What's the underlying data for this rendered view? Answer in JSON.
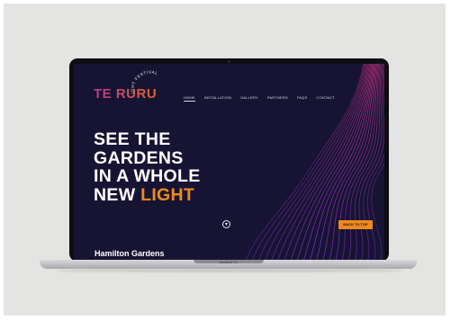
{
  "brand": {
    "logo_text": "TE RURU",
    "tagline": "LIGHT FESTIVAL"
  },
  "nav": {
    "items": [
      {
        "label": "HOME",
        "active": true
      },
      {
        "label": "INSTALLATION",
        "active": false
      },
      {
        "label": "GALLERY",
        "active": false
      },
      {
        "label": "PARTNERS",
        "active": false
      },
      {
        "label": "FAQS",
        "active": false
      },
      {
        "label": "CONTACT",
        "active": false
      }
    ]
  },
  "hero": {
    "line1": "SEE THE",
    "line2": "GARDENS",
    "line3": "IN A WHOLE",
    "line4_prefix": "NEW",
    "line4_accent": "LIGHT",
    "scroll_icon": "chevron-down-icon"
  },
  "back_to_top_label": "BACK TO TOP",
  "footer": {
    "title": "Hamilton Gardens"
  },
  "device": {
    "label": "MacBook Pro"
  },
  "colors": {
    "background": "#e4e4e2",
    "screen_bg": "#171433",
    "accent": "#f08a1c",
    "line_art_start": "#c0307a",
    "line_art_end": "#7a2fd0"
  }
}
